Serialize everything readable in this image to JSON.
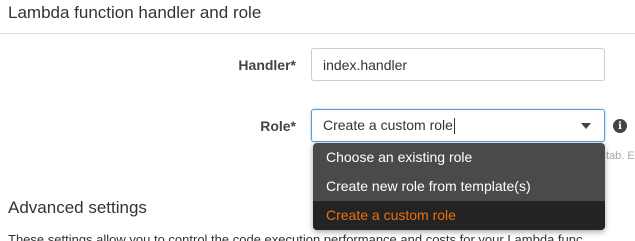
{
  "section": {
    "title": "Lambda function handler and role"
  },
  "handler": {
    "label": "Handler*",
    "value": "index.handler"
  },
  "role": {
    "label": "Role*",
    "selected": "Create a custom role",
    "options": [
      "Choose an existing role",
      "Create new role from template(s)",
      "Create a custom role"
    ],
    "info_icon": "info-icon",
    "hint_partial": "tab. E"
  },
  "advanced": {
    "title": "Advanced settings",
    "description": "These settings allow you to control the code execution performance and costs for your Lambda func"
  },
  "colors": {
    "dropdown_bg": "#4a4a4a",
    "selected_bg": "#232323",
    "selected_text": "#ec7211",
    "focus_border": "#5b9bd5"
  }
}
